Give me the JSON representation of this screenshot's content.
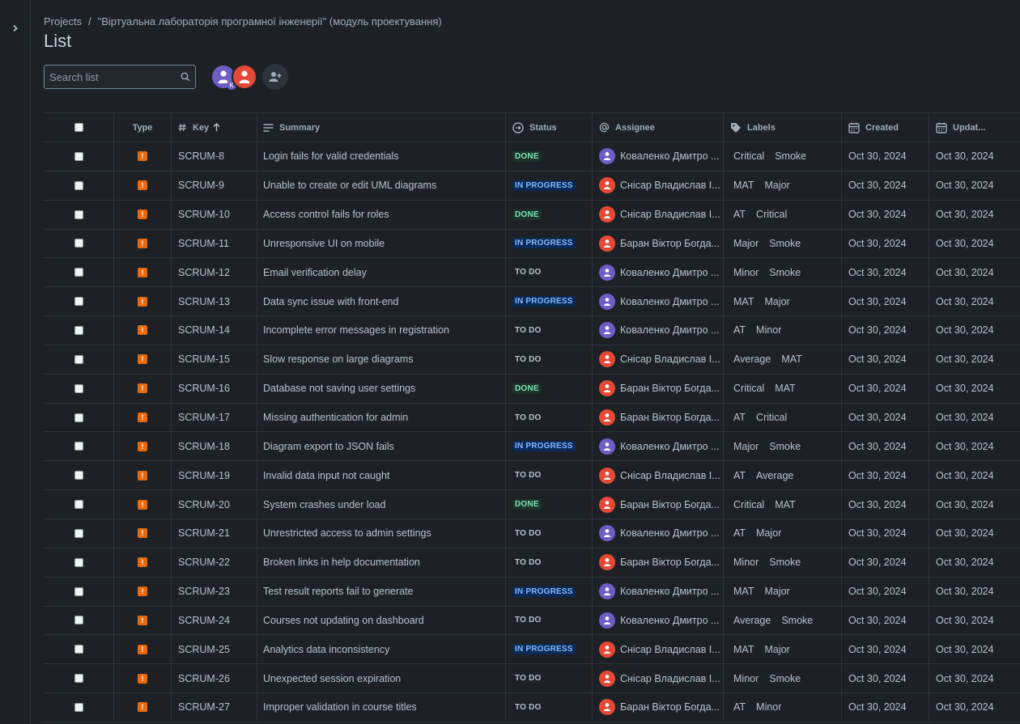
{
  "breadcrumb": {
    "projects": "Projects",
    "separator": "/",
    "project_name": "\"Віртуальна лабораторія програмної інженерії\" (модуль проектування)"
  },
  "page_title": "List",
  "search": {
    "placeholder": "Search list"
  },
  "avatars": {
    "badge_letter": "K"
  },
  "columns": {
    "type": "Type",
    "key": "Key",
    "summary": "Summary",
    "status": "Status",
    "assignee": "Assignee",
    "labels": "Labels",
    "created": "Created",
    "updated": "Updat..."
  },
  "colors": {
    "done_bg": "#1c3329",
    "progress_bg": "#092957",
    "bug_orange": "#e56910",
    "avatar_purple": "#6e5dc6",
    "avatar_red": "#e34935"
  },
  "rows": [
    {
      "key": "SCRUM-8",
      "summary": "Login fails for valid credentials",
      "status": "DONE",
      "assignee": "Коваленко Дмитро ...",
      "avatar": "purple",
      "labels": [
        "Critical",
        "Smoke"
      ],
      "created": "Oct 30, 2024",
      "updated": "Oct 30, 2024"
    },
    {
      "key": "SCRUM-9",
      "summary": "Unable to create or edit UML diagrams",
      "status": "IN PROGRESS",
      "assignee": "Снісар Владислав І...",
      "avatar": "red",
      "labels": [
        "MAT",
        "Major"
      ],
      "created": "Oct 30, 2024",
      "updated": "Oct 30, 2024"
    },
    {
      "key": "SCRUM-10",
      "summary": "Access control fails for roles",
      "status": "DONE",
      "assignee": "Снісар Владислав І...",
      "avatar": "red",
      "labels": [
        "AT",
        "Critical"
      ],
      "created": "Oct 30, 2024",
      "updated": "Oct 30, 2024"
    },
    {
      "key": "SCRUM-11",
      "summary": "Unresponsive UI on mobile",
      "status": "IN PROGRESS",
      "assignee": "Баран Віктор Богда...",
      "avatar": "red",
      "labels": [
        "Major",
        "Smoke"
      ],
      "created": "Oct 30, 2024",
      "updated": "Oct 30, 2024"
    },
    {
      "key": "SCRUM-12",
      "summary": "Email verification delay",
      "status": "TO DO",
      "assignee": "Коваленко Дмитро ...",
      "avatar": "purple",
      "labels": [
        "Minor",
        "Smoke"
      ],
      "created": "Oct 30, 2024",
      "updated": "Oct 30, 2024"
    },
    {
      "key": "SCRUM-13",
      "summary": "Data sync issue with front-end",
      "status": "IN PROGRESS",
      "assignee": "Коваленко Дмитро ...",
      "avatar": "purple",
      "labels": [
        "MAT",
        "Major"
      ],
      "created": "Oct 30, 2024",
      "updated": "Oct 30, 2024"
    },
    {
      "key": "SCRUM-14",
      "summary": "Incomplete error messages in registration",
      "status": "TO DO",
      "assignee": "Коваленко Дмитро ...",
      "avatar": "purple",
      "labels": [
        "AT",
        "Minor"
      ],
      "created": "Oct 30, 2024",
      "updated": "Oct 30, 2024"
    },
    {
      "key": "SCRUM-15",
      "summary": "Slow response on large diagrams",
      "status": "TO DO",
      "assignee": "Снісар Владислав І...",
      "avatar": "red",
      "labels": [
        "Average",
        "MAT"
      ],
      "created": "Oct 30, 2024",
      "updated": "Oct 30, 2024"
    },
    {
      "key": "SCRUM-16",
      "summary": "Database not saving user settings",
      "status": "DONE",
      "assignee": "Баран Віктор Богда...",
      "avatar": "red",
      "labels": [
        "Critical",
        "MAT"
      ],
      "created": "Oct 30, 2024",
      "updated": "Oct 30, 2024"
    },
    {
      "key": "SCRUM-17",
      "summary": "Missing authentication for admin",
      "status": "TO DO",
      "assignee": "Баран Віктор Богда...",
      "avatar": "red",
      "labels": [
        "AT",
        "Critical"
      ],
      "created": "Oct 30, 2024",
      "updated": "Oct 30, 2024"
    },
    {
      "key": "SCRUM-18",
      "summary": "Diagram export to JSON fails",
      "status": "IN PROGRESS",
      "assignee": "Коваленко Дмитро ...",
      "avatar": "purple",
      "labels": [
        "Major",
        "Smoke"
      ],
      "created": "Oct 30, 2024",
      "updated": "Oct 30, 2024"
    },
    {
      "key": "SCRUM-19",
      "summary": "Invalid data input not caught",
      "status": "TO DO",
      "assignee": "Снісар Владислав І...",
      "avatar": "red",
      "labels": [
        "AT",
        "Average"
      ],
      "created": "Oct 30, 2024",
      "updated": "Oct 30, 2024"
    },
    {
      "key": "SCRUM-20",
      "summary": "System crashes under load",
      "status": "DONE",
      "assignee": "Баран Віктор Богда...",
      "avatar": "red",
      "labels": [
        "Critical",
        "MAT"
      ],
      "created": "Oct 30, 2024",
      "updated": "Oct 30, 2024"
    },
    {
      "key": "SCRUM-21",
      "summary": "Unrestricted access to admin settings",
      "status": "TO DO",
      "assignee": "Коваленко Дмитро ...",
      "avatar": "purple",
      "labels": [
        "AT",
        "Major"
      ],
      "created": "Oct 30, 2024",
      "updated": "Oct 30, 2024"
    },
    {
      "key": "SCRUM-22",
      "summary": "Broken links in help documentation",
      "status": "TO DO",
      "assignee": "Баран Віктор Богда...",
      "avatar": "red",
      "labels": [
        "Minor",
        "Smoke"
      ],
      "created": "Oct 30, 2024",
      "updated": "Oct 30, 2024"
    },
    {
      "key": "SCRUM-23",
      "summary": "Test result reports fail to generate",
      "status": "IN PROGRESS",
      "assignee": "Коваленко Дмитро ...",
      "avatar": "purple",
      "labels": [
        "MAT",
        "Major"
      ],
      "created": "Oct 30, 2024",
      "updated": "Oct 30, 2024"
    },
    {
      "key": "SCRUM-24",
      "summary": "Courses not updating on dashboard",
      "status": "TO DO",
      "assignee": "Коваленко Дмитро ...",
      "avatar": "purple",
      "labels": [
        "Average",
        "Smoke"
      ],
      "created": "Oct 30, 2024",
      "updated": "Oct 30, 2024"
    },
    {
      "key": "SCRUM-25",
      "summary": "Analytics data inconsistency",
      "status": "IN PROGRESS",
      "assignee": "Снісар Владислав І...",
      "avatar": "red",
      "labels": [
        "MAT",
        "Major"
      ],
      "created": "Oct 30, 2024",
      "updated": "Oct 30, 2024"
    },
    {
      "key": "SCRUM-26",
      "summary": "Unexpected session expiration",
      "status": "TO DO",
      "assignee": "Снісар Владислав І...",
      "avatar": "red",
      "labels": [
        "Minor",
        "Smoke"
      ],
      "created": "Oct 30, 2024",
      "updated": "Oct 30, 2024"
    },
    {
      "key": "SCRUM-27",
      "summary": "Improper validation in course titles",
      "status": "TO DO",
      "assignee": "Баран Віктор Богда...",
      "avatar": "red",
      "labels": [
        "AT",
        "Minor"
      ],
      "created": "Oct 30, 2024",
      "updated": "Oct 30, 2024"
    }
  ]
}
